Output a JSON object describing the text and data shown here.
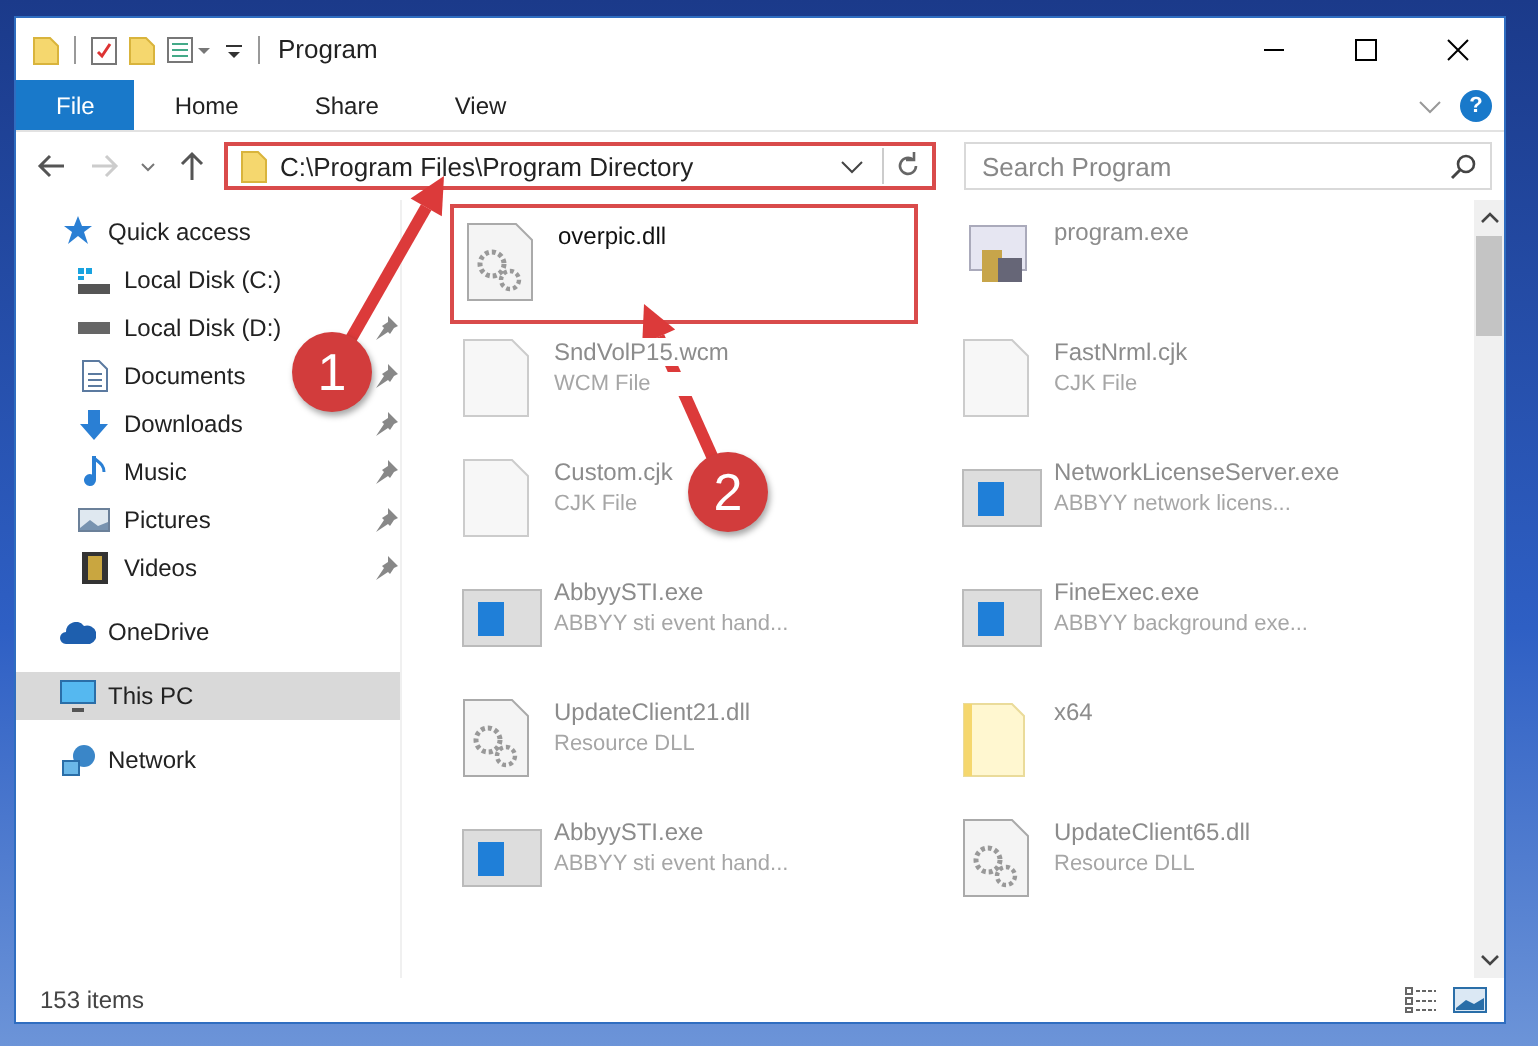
{
  "window": {
    "title": "Program"
  },
  "ribbon_tabs": [
    {
      "label": "File",
      "selected": true
    },
    {
      "label": "Home",
      "selected": false
    },
    {
      "label": "Share",
      "selected": false
    },
    {
      "label": "View",
      "selected": false
    }
  ],
  "help": {
    "label": "?"
  },
  "address": {
    "path": "C:\\Program Files\\Program Directory"
  },
  "search": {
    "placeholder": "Search Program"
  },
  "sidebar": {
    "items": [
      {
        "label": "Quick access",
        "kind": "star",
        "selected": false,
        "children": [
          {
            "label": "Local Disk (C:)",
            "kind": "drive-c",
            "pinned": false,
            "selected": false
          },
          {
            "label": "Local Disk (D:)",
            "kind": "drive",
            "pinned": true,
            "selected": false
          },
          {
            "label": "Documents",
            "kind": "doc",
            "pinned": true,
            "selected": false
          },
          {
            "label": "Downloads",
            "kind": "down",
            "pinned": true,
            "selected": false
          },
          {
            "label": "Music",
            "kind": "music",
            "pinned": true,
            "selected": false
          },
          {
            "label": "Pictures",
            "kind": "pictures",
            "pinned": true,
            "selected": false
          },
          {
            "label": "Videos",
            "kind": "videos",
            "pinned": true,
            "selected": false
          }
        ]
      },
      {
        "label": "OneDrive",
        "kind": "cloud",
        "selected": false
      },
      {
        "label": "This PC",
        "kind": "pc",
        "selected": true
      },
      {
        "label": "Network",
        "kind": "network",
        "selected": false
      }
    ]
  },
  "files": [
    {
      "name": "overpic.dll",
      "kind": "dll",
      "highlighted": true
    },
    {
      "name": "program.exe",
      "kind": "program",
      "highlighted": false
    },
    {
      "name": "SndVolP15.wcm",
      "type": "WCM File",
      "kind": "blank",
      "highlighted": false
    },
    {
      "name": "FastNrml.cjk",
      "type": "CJK File",
      "kind": "blank",
      "highlighted": false
    },
    {
      "name": "Custom.cjk",
      "type": "CJK File",
      "kind": "blank",
      "highlighted": false
    },
    {
      "name": "NetworkLicenseServer.exe",
      "type": "ABBYY network licens...",
      "kind": "app",
      "highlighted": false
    },
    {
      "name": "AbbyySTI.exe",
      "type": "ABBYY sti event hand...",
      "kind": "app",
      "highlighted": false
    },
    {
      "name": "FineExec.exe",
      "type": "ABBYY background exe...",
      "kind": "app",
      "highlighted": false
    },
    {
      "name": "UpdateClient21.dll",
      "type": "Resource DLL",
      "kind": "dll",
      "highlighted": false
    },
    {
      "name": "x64",
      "kind": "folder",
      "highlighted": false
    },
    {
      "name": "AbbyySTI.exe",
      "type": "ABBYY sti event hand...",
      "kind": "app",
      "highlighted": false
    },
    {
      "name": "UpdateClient65.dll",
      "type": "Resource DLL",
      "kind": "dll",
      "highlighted": false
    }
  ],
  "status_bar": {
    "count": "153 items"
  },
  "annotations": [
    {
      "label": "1"
    },
    {
      "label": "2"
    }
  ]
}
